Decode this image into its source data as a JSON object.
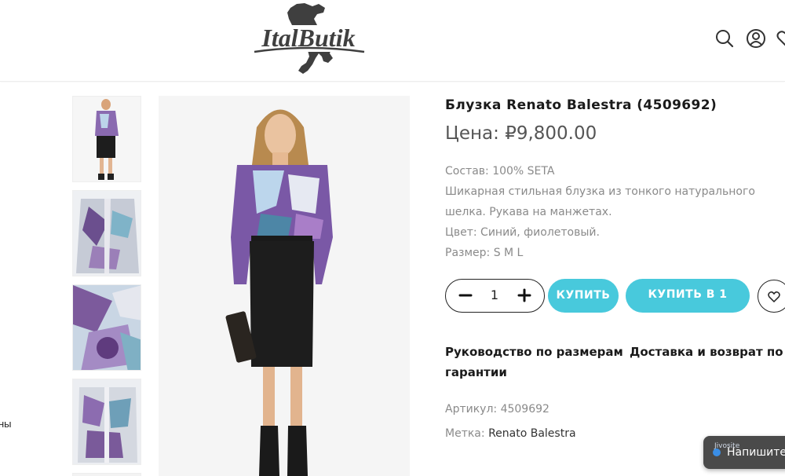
{
  "header": {
    "logo_text": "ItalButik",
    "icons": [
      "search-icon",
      "user-icon",
      "wishlist-icon"
    ]
  },
  "left_cut_text": "ны",
  "product": {
    "title": "Блузка Renato Balestra (4509692)",
    "price": "Цена: ₽9,800.00",
    "description": [
      "Состав: 100% SETA",
      "Шикарная стильная блузка из тонкого натурального",
      "шелка. Рукава на манжетах.",
      "Цвет: Синий, фиолетовый.",
      "Размер: S M L"
    ],
    "quantity": "1",
    "buy_label": "КУПИТЬ",
    "buy_one_click_label": "КУПИТЬ В 1",
    "size_guide_label": "Руководство по размерам",
    "delivery_label_line1": "Доставка и возврат по",
    "delivery_label_line2": "гарантии",
    "sku_label": "Артикул: 4509692",
    "tag_prefix": "Метка: ",
    "tag_value": "Renato Balestra"
  },
  "chat": {
    "small_text": "Jivosite",
    "label": "Напишите"
  },
  "colors": {
    "accent": "#48c9dc",
    "text_dark": "#1a1a1a",
    "text_muted": "#8a8a8a"
  }
}
